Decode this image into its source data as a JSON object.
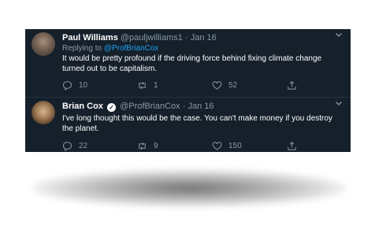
{
  "tweets": [
    {
      "name": "Paul Williams",
      "handle": "@pauljwilliams1",
      "date": "Jan 16",
      "replying_prefix": "Replying to ",
      "replying_to": "@ProfBrianCox",
      "text": "It would be pretty profound if the driving force behind fixing climate change turned out to be capitalism.",
      "replies": "10",
      "retweets": "1",
      "likes": "52"
    },
    {
      "name": "Brian Cox",
      "handle": "@ProfBrianCox",
      "date": "Jan 16",
      "verified": true,
      "text": "I've long thought this would be the case. You can't make money if you destroy the planet.",
      "replies": "22",
      "retweets": "9",
      "likes": "150"
    }
  ],
  "separator": "·",
  "icons": {
    "reply": "reply-icon",
    "retweet": "retweet-icon",
    "like": "heart-icon",
    "share": "share-icon",
    "menu": "chevron-down-icon",
    "verified": "verified-badge-icon"
  },
  "colors": {
    "background": "#15202b",
    "text": "#ffffff",
    "secondary": "#8899a6",
    "link": "#1da1f2"
  }
}
